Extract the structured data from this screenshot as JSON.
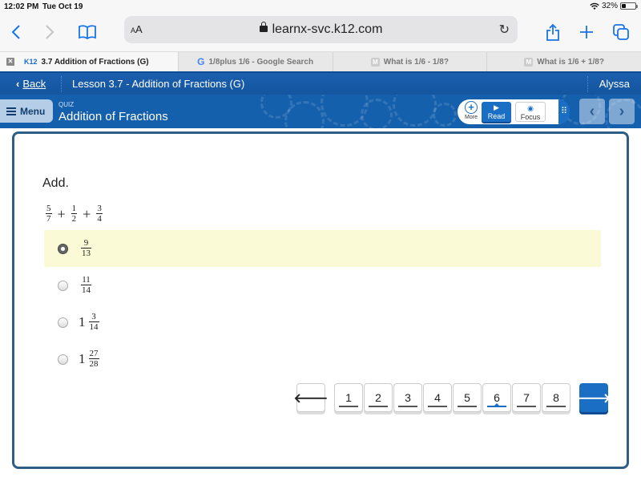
{
  "status_bar": {
    "time": "12:02 PM",
    "date": "Tue Oct 19",
    "battery_percent": "32%",
    "battery_level": 0.32
  },
  "browser": {
    "text_size_label": "AA",
    "url": "learnx-svc.k12.com",
    "icons": [
      "back-icon",
      "forward-icon",
      "bookmarks-icon",
      "lock-icon",
      "reload-icon",
      "share-icon",
      "new-tab-icon",
      "tabs-icon"
    ]
  },
  "tabs": [
    {
      "label": "3.7 Addition of Fractions (G)",
      "favicon": "K12",
      "active": true
    },
    {
      "label": "1/8plus 1/6 - Google Search",
      "favicon": "G",
      "active": false
    },
    {
      "label": "What is 1/6 - 1/8?",
      "favicon": "M",
      "active": false
    },
    {
      "label": "What is 1/6 + 1/8?",
      "favicon": "M",
      "active": false
    }
  ],
  "lesson_bar": {
    "back_label": "Back",
    "lesson_title": "Lesson 3.7 - Addition of Fractions (G)",
    "user_name": "Alyssa"
  },
  "quiz_bar": {
    "menu_label": "Menu",
    "kind": "QUIZ",
    "title": "Addition of Fractions",
    "tools": {
      "more_label": "More",
      "read_label": "Read",
      "focus_label": "Focus"
    }
  },
  "question": {
    "prompt": "Add.",
    "expression": [
      {
        "num": "5",
        "den": "7"
      },
      {
        "op": "+"
      },
      {
        "num": "1",
        "den": "2"
      },
      {
        "op": "+"
      },
      {
        "num": "3",
        "den": "4"
      }
    ],
    "choices": [
      {
        "whole": "",
        "num": "9",
        "den": "13",
        "selected": true
      },
      {
        "whole": "",
        "num": "11",
        "den": "14",
        "selected": false
      },
      {
        "whole": "1",
        "num": "3",
        "den": "14",
        "selected": false
      },
      {
        "whole": "1",
        "num": "27",
        "den": "28",
        "selected": false
      }
    ]
  },
  "pager": {
    "pages": [
      "1",
      "2",
      "3",
      "4",
      "5",
      "6",
      "7",
      "8"
    ],
    "current": "6",
    "prev_icon": "arrow-left-icon",
    "next_icon": "arrow-right-icon"
  }
}
